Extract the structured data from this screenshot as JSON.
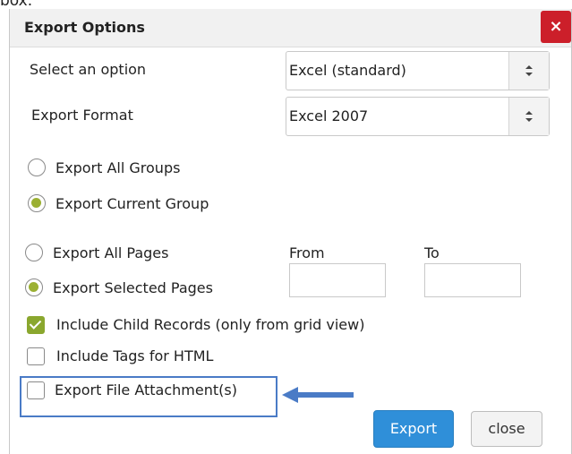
{
  "top_crop_text": "box.",
  "dialog": {
    "title": "Export Options",
    "close_icon_label": "×"
  },
  "select_option": {
    "label": "Select an option",
    "value": "Excel (standard)"
  },
  "export_format": {
    "label": "Export Format",
    "value": "Excel 2007"
  },
  "groups": {
    "all": {
      "label": "Export All Groups",
      "checked": false
    },
    "current": {
      "label": "Export Current Group",
      "checked": true
    }
  },
  "pages": {
    "all": {
      "label": "Export All Pages",
      "checked": false
    },
    "selected": {
      "label": "Export Selected Pages",
      "checked": true
    },
    "from_label": "From",
    "to_label": "To",
    "from_value": "",
    "to_value": ""
  },
  "options": {
    "child_records": {
      "label": "Include Child Records (only from grid view)",
      "checked": true
    },
    "tags_html": {
      "label": "Include Tags for HTML",
      "checked": false
    },
    "file_attachments": {
      "label": "Export File Attachment(s)",
      "checked": false
    }
  },
  "buttons": {
    "export": "Export",
    "close": "close"
  },
  "colors": {
    "close_red": "#cc1f2a",
    "radio_green": "#9bb033",
    "check_green": "#8aa72e",
    "export_blue": "#2f8fd9",
    "highlight_blue": "#4a7bc6"
  },
  "icons": [
    "close-icon",
    "select-arrow-icon",
    "annotation-arrow-icon"
  ]
}
